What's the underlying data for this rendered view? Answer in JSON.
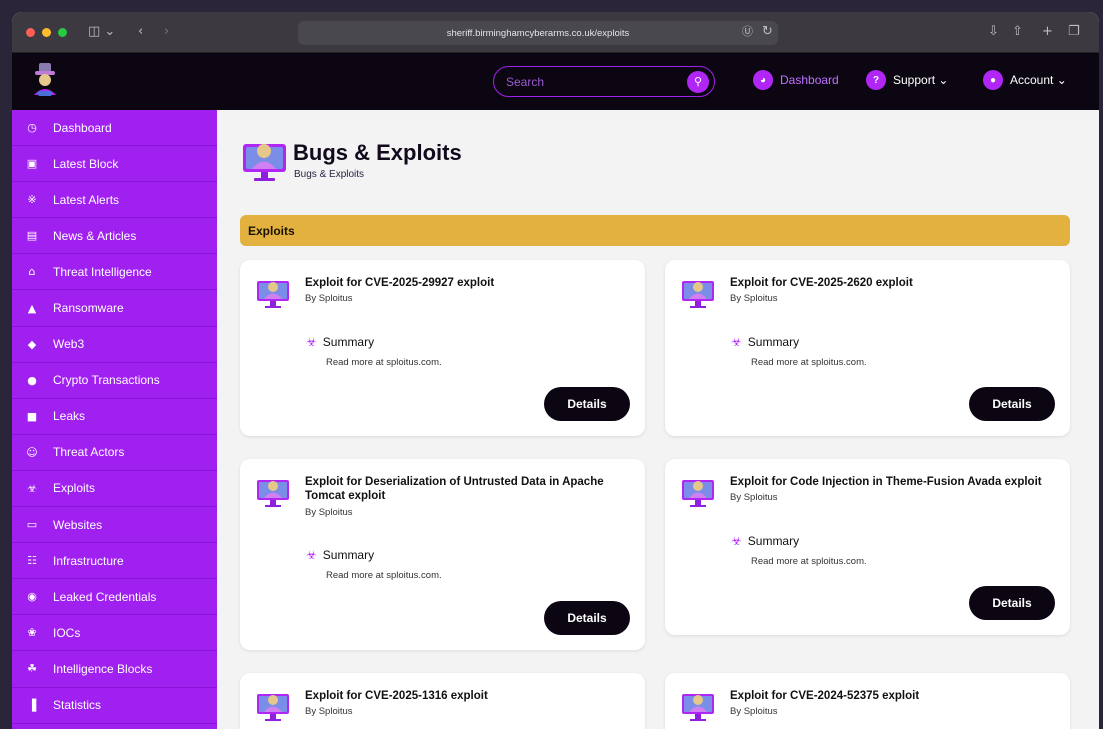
{
  "browser": {
    "url": "sheriff.birminghamcyberarms.co.uk/exploits"
  },
  "header": {
    "search_placeholder": "Search",
    "nav": [
      {
        "label": "Dashboard",
        "icon": "dashboard-icon"
      },
      {
        "label": "Support ⌄",
        "icon": "help-icon"
      },
      {
        "label": "Account ⌄",
        "icon": "user-icon"
      }
    ]
  },
  "sidebar": {
    "items": [
      {
        "label": "Dashboard",
        "icon": "◷"
      },
      {
        "label": "Latest Block",
        "icon": "▣"
      },
      {
        "label": "Latest Alerts",
        "icon": "※"
      },
      {
        "label": "News & Articles",
        "icon": "▤"
      },
      {
        "label": "Threat Intelligence",
        "icon": "⌂"
      },
      {
        "label": "Ransomware",
        "icon": "▲"
      },
      {
        "label": "Web3",
        "icon": "◆"
      },
      {
        "label": "Crypto Transactions",
        "icon": "●"
      },
      {
        "label": "Leaks",
        "icon": "■"
      },
      {
        "label": "Threat Actors",
        "icon": "☺"
      },
      {
        "label": "Exploits",
        "icon": "☣"
      },
      {
        "label": "Websites",
        "icon": "▭"
      },
      {
        "label": "Infrastructure",
        "icon": "☷"
      },
      {
        "label": "Leaked Credentials",
        "icon": "◉"
      },
      {
        "label": "IOCs",
        "icon": "❀"
      },
      {
        "label": "Intelligence Blocks",
        "icon": "☘"
      },
      {
        "label": "Statistics",
        "icon": "▐"
      }
    ]
  },
  "page": {
    "title": "Bugs & Exploits",
    "breadcrumb": "Bugs & Exploits",
    "section": "Exploits"
  },
  "cards": [
    {
      "title": "Exploit for CVE-2025-29927 exploit",
      "by": "By Sploitus",
      "summary_label": "Summary",
      "summary": "Read more at sploitus.com.",
      "button": "Details"
    },
    {
      "title": "Exploit for CVE-2025-2620 exploit",
      "by": "By Sploitus",
      "summary_label": "Summary",
      "summary": "Read more at sploitus.com.",
      "button": "Details"
    },
    {
      "title": "Exploit for Deserialization of Untrusted Data in Apache Tomcat exploit",
      "by": "By Sploitus",
      "summary_label": "Summary",
      "summary": "Read more at sploitus.com.",
      "button": "Details"
    },
    {
      "title": "Exploit for Code Injection in Theme-Fusion Avada exploit",
      "by": "By Sploitus",
      "summary_label": "Summary",
      "summary": "Read more at sploitus.com.",
      "button": "Details"
    },
    {
      "title": "Exploit for CVE-2025-1316 exploit",
      "by": "By Sploitus"
    },
    {
      "title": "Exploit for CVE-2024-52375 exploit",
      "by": "By Sploitus"
    }
  ],
  "colors": {
    "accent": "#a020f0",
    "section_bar": "#e2b13f",
    "header_bg": "#0c0612"
  }
}
